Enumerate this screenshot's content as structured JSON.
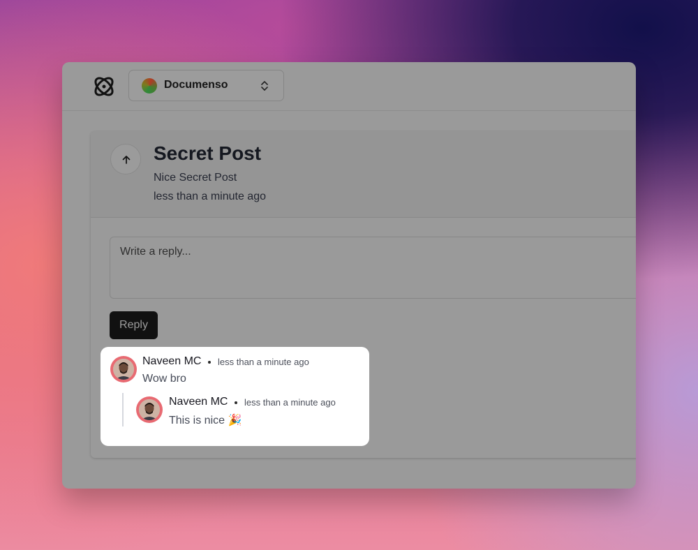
{
  "topbar": {
    "logo_icon": "atom-icon",
    "team": {
      "name": "Documenso",
      "selector_icon": "chevron-up-down-icon"
    }
  },
  "post": {
    "title": "Secret Post",
    "description": "Nice Secret Post",
    "time": "less than a minute ago",
    "upvote_icon": "arrow-up-icon"
  },
  "reply": {
    "placeholder": "Write a reply...",
    "button_label": "Reply"
  },
  "comments": [
    {
      "author": "Naveen MC",
      "time": "less than a minute ago",
      "text": "Wow bro",
      "replies": [
        {
          "author": "Naveen MC",
          "time": "less than a minute ago",
          "text": "This is nice 🎉"
        }
      ]
    }
  ],
  "colors": {
    "reply_button_bg": "#111111",
    "avatar_bg": "#e86a72",
    "comment_card_bg": "#ffffff"
  }
}
